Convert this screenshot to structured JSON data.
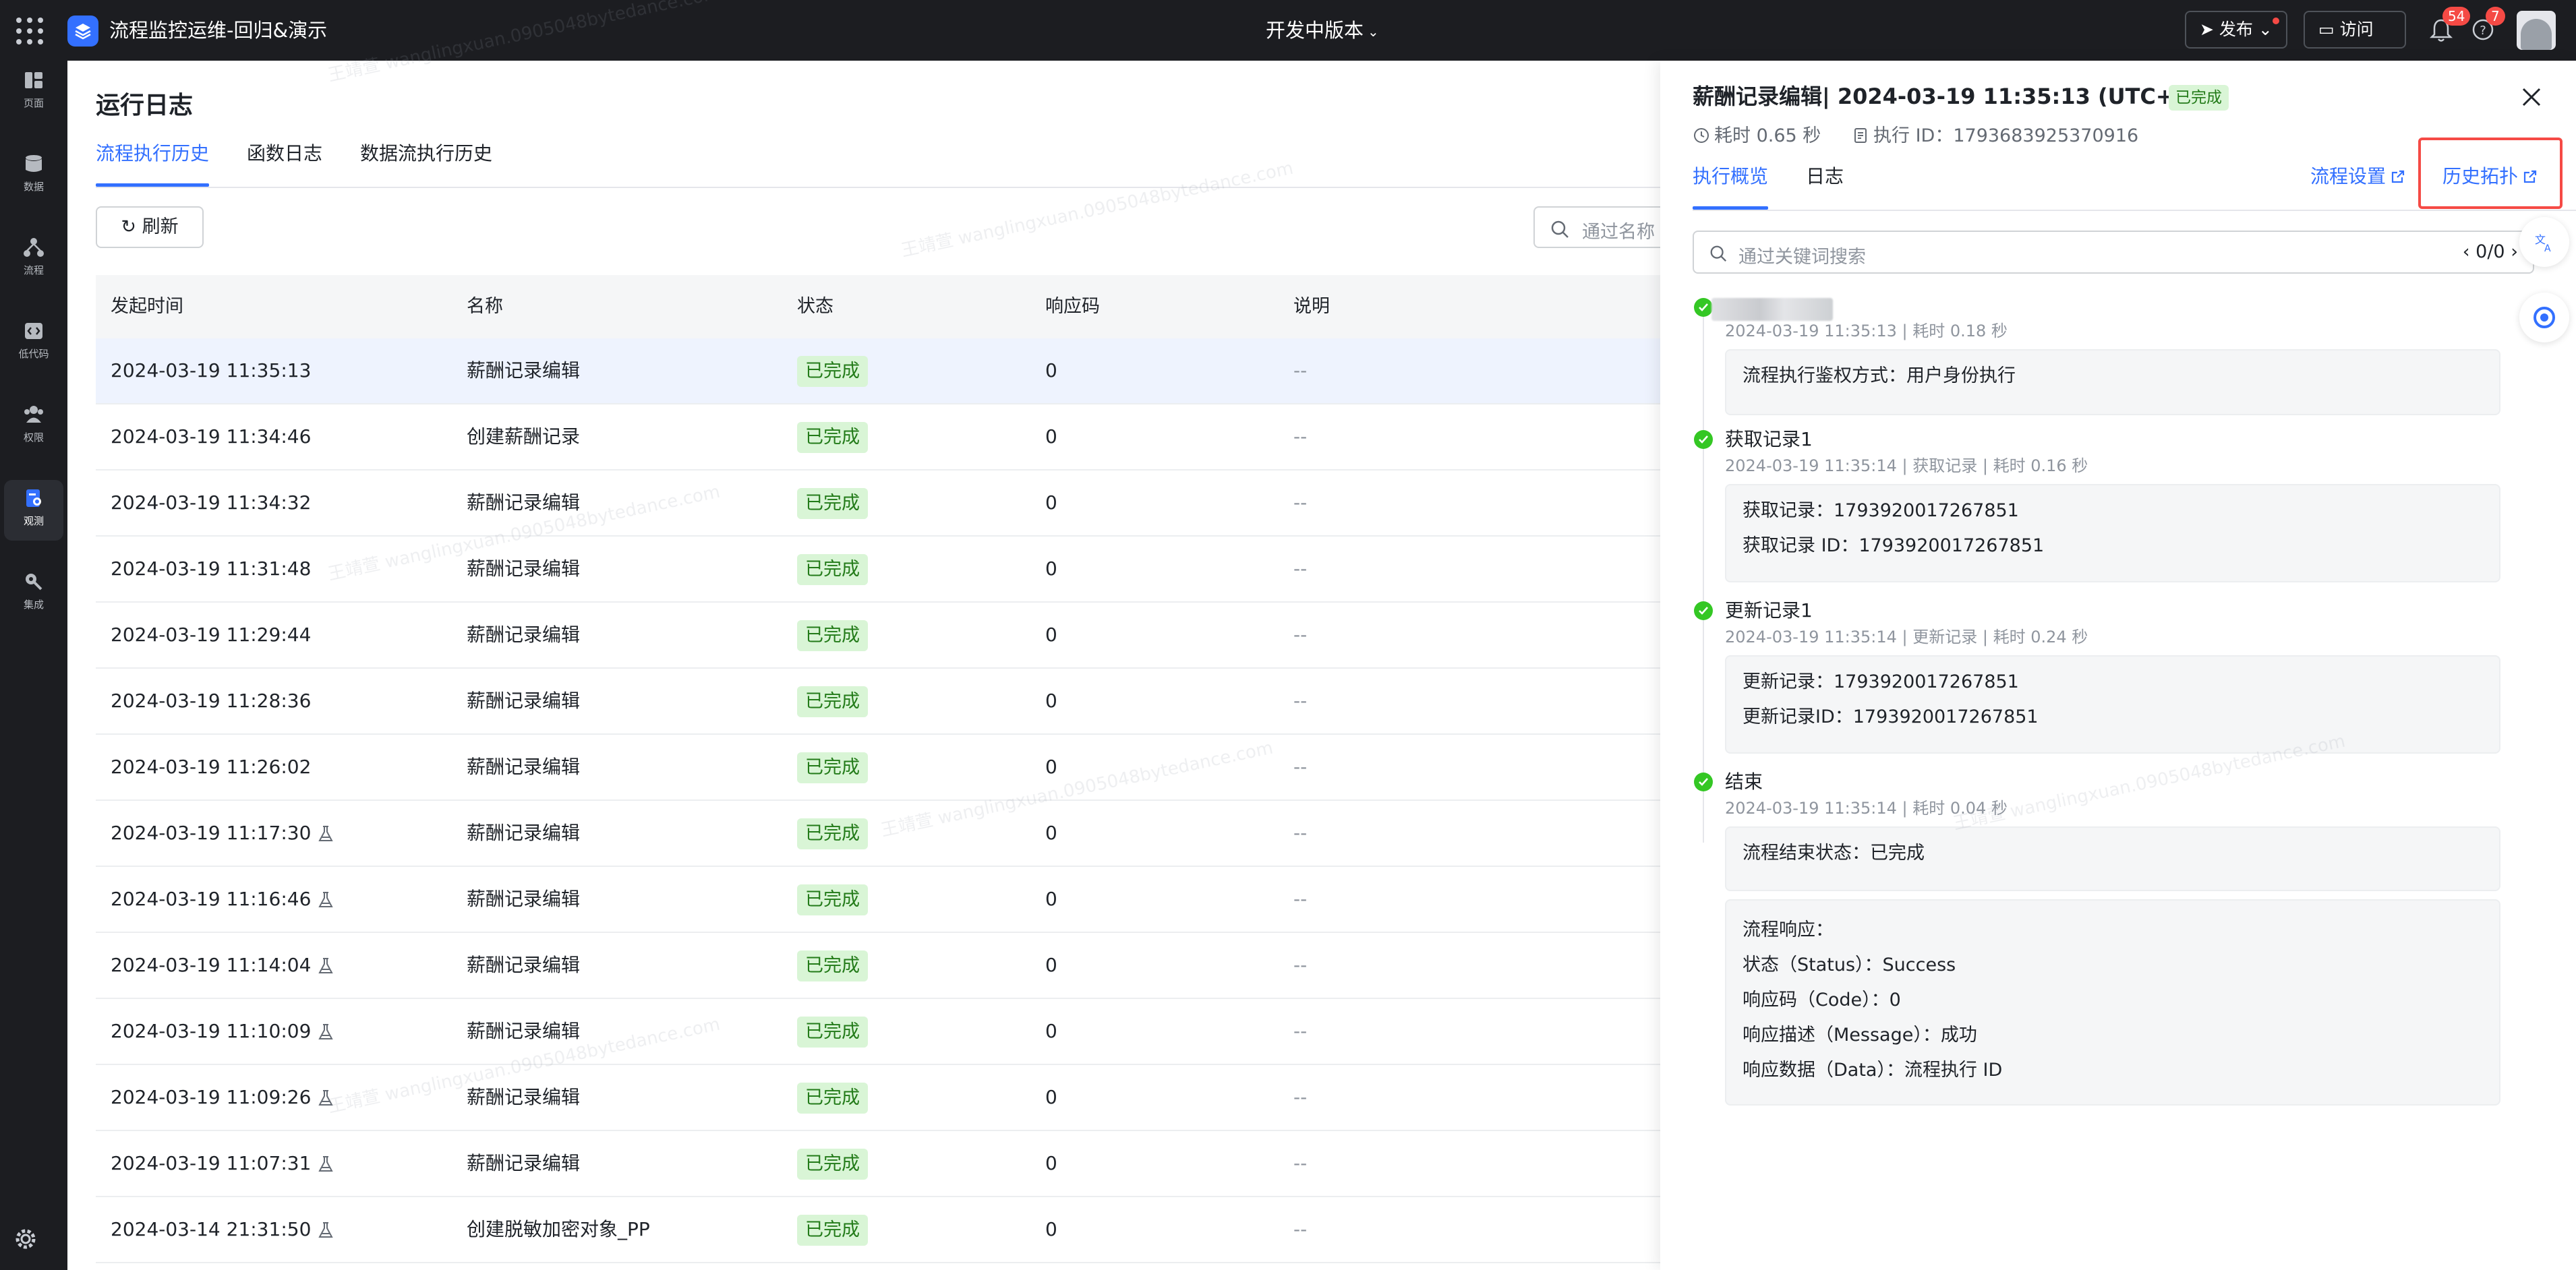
{
  "topbar": {
    "app_title": "流程监控运维-回归&演示",
    "version_label": "开发中版本",
    "publish_label": "发布",
    "visit_label": "访问",
    "notifications_count": "54",
    "help_count": "7"
  },
  "nav": {
    "items": [
      {
        "label": "页面",
        "icon": "page-icon"
      },
      {
        "label": "数据",
        "icon": "database-icon"
      },
      {
        "label": "流程",
        "icon": "flow-icon"
      },
      {
        "label": "低代码",
        "icon": "code-icon"
      },
      {
        "label": "权限",
        "icon": "users-icon"
      },
      {
        "label": "观测",
        "icon": "monitor-icon"
      },
      {
        "label": "集成",
        "icon": "key-icon"
      }
    ],
    "active": "观测"
  },
  "main": {
    "title": "运行日志",
    "tabs": [
      "流程执行历史",
      "函数日志",
      "数据流执行历史"
    ],
    "active_tab": "流程执行历史",
    "refresh_label": "刷新",
    "search_placeholder": "通过名称",
    "columns": [
      "发起时间",
      "名称",
      "状态",
      "响应码",
      "说明"
    ],
    "rows": [
      {
        "time": "2024-03-19 11:35:13",
        "name": "薪酬记录编辑",
        "status": "已完成",
        "code": "0",
        "desc": "--",
        "test": false
      },
      {
        "time": "2024-03-19 11:34:46",
        "name": "创建薪酬记录",
        "status": "已完成",
        "code": "0",
        "desc": "--",
        "test": false
      },
      {
        "time": "2024-03-19 11:34:32",
        "name": "薪酬记录编辑",
        "status": "已完成",
        "code": "0",
        "desc": "--",
        "test": false
      },
      {
        "time": "2024-03-19 11:31:48",
        "name": "薪酬记录编辑",
        "status": "已完成",
        "code": "0",
        "desc": "--",
        "test": false
      },
      {
        "time": "2024-03-19 11:29:44",
        "name": "薪酬记录编辑",
        "status": "已完成",
        "code": "0",
        "desc": "--",
        "test": false
      },
      {
        "time": "2024-03-19 11:28:36",
        "name": "薪酬记录编辑",
        "status": "已完成",
        "code": "0",
        "desc": "--",
        "test": false
      },
      {
        "time": "2024-03-19 11:26:02",
        "name": "薪酬记录编辑",
        "status": "已完成",
        "code": "0",
        "desc": "--",
        "test": false
      },
      {
        "time": "2024-03-19 11:17:30",
        "name": "薪酬记录编辑",
        "status": "已完成",
        "code": "0",
        "desc": "--",
        "test": true
      },
      {
        "time": "2024-03-19 11:16:46",
        "name": "薪酬记录编辑",
        "status": "已完成",
        "code": "0",
        "desc": "--",
        "test": true
      },
      {
        "time": "2024-03-19 11:14:04",
        "name": "薪酬记录编辑",
        "status": "已完成",
        "code": "0",
        "desc": "--",
        "test": true
      },
      {
        "time": "2024-03-19 11:10:09",
        "name": "薪酬记录编辑",
        "status": "已完成",
        "code": "0",
        "desc": "--",
        "test": true
      },
      {
        "time": "2024-03-19 11:09:26",
        "name": "薪酬记录编辑",
        "status": "已完成",
        "code": "0",
        "desc": "--",
        "test": true
      },
      {
        "time": "2024-03-19 11:07:31",
        "name": "薪酬记录编辑",
        "status": "已完成",
        "code": "0",
        "desc": "--",
        "test": true
      },
      {
        "time": "2024-03-14 21:31:50",
        "name": "创建脱敏加密对象_PP",
        "status": "已完成",
        "code": "0",
        "desc": "--",
        "test": true
      }
    ]
  },
  "drawer": {
    "title": "薪酬记录编辑| 2024-03-19 11:35:13 (UTC+8)",
    "status": "已完成",
    "duration": "耗时 0.65 秒",
    "exec_id": "执行 ID：1793683925370916",
    "tabs": [
      "执行概览",
      "日志"
    ],
    "active_tab": "执行概览",
    "link_settings": "流程设置",
    "link_history": "历史拓扑",
    "search_placeholder": "通过关键词搜索",
    "search_count": "0/0",
    "steps": [
      {
        "name": "",
        "meta": "2024-03-19 11:35:13 | 耗时 0.18 秒",
        "lines": [
          "流程执行鉴权方式：用户身份执行"
        ]
      },
      {
        "name": "获取记录1",
        "meta": "2024-03-19 11:35:14 | 获取记录 | 耗时 0.16 秒",
        "lines": [
          "获取记录：1793920017267851",
          "获取记录 ID：1793920017267851"
        ]
      },
      {
        "name": "更新记录1",
        "meta": "2024-03-19 11:35:14 | 更新记录 | 耗时 0.24 秒",
        "lines": [
          "更新记录：1793920017267851",
          "更新记录ID：1793920017267851"
        ]
      },
      {
        "name": "结束",
        "meta": "2024-03-19 11:35:14 | 耗时 0.04 秒",
        "lines": [
          "流程结束状态：已完成"
        ]
      }
    ],
    "response": {
      "title": "流程响应：",
      "lines": [
        "状态（Status）：Success",
        "响应码（Code）：0",
        "响应描述（Message）：成功",
        "响应数据（Data）：流程执行 ID"
      ]
    }
  },
  "watermark": "王靖萱 wanglingxuan.0905048bytedance.com",
  "colors": {
    "accent": "#3370ff",
    "success_bg": "#d9f5d6",
    "success_text": "#237b19",
    "topbar": "#1c1d21",
    "highlight": "#f54a45"
  }
}
